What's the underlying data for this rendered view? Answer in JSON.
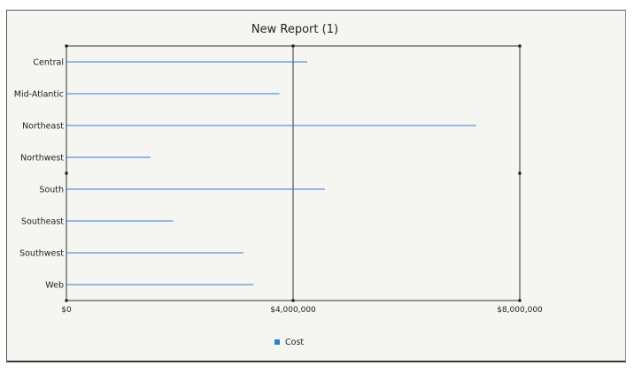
{
  "chart_data": {
    "type": "bar",
    "orientation": "horizontal",
    "title": "New Report (1)",
    "categories": [
      "Central",
      "Mid-Atlantic",
      "Northeast",
      "Northwest",
      "South",
      "Southeast",
      "Southwest",
      "Web"
    ],
    "series": [
      {
        "name": "Cost",
        "color": "#2f7fd6",
        "values": [
          4250000,
          3760000,
          7230000,
          1480000,
          4560000,
          1880000,
          3120000,
          3300000
        ]
      }
    ],
    "xlim": [
      0,
      8000000
    ],
    "xticks": [
      0,
      4000000,
      8000000
    ],
    "xtick_labels": [
      "$0",
      "$4,000,000",
      "$8,000,000"
    ],
    "grid": true,
    "legend_position": "bottom-center"
  }
}
